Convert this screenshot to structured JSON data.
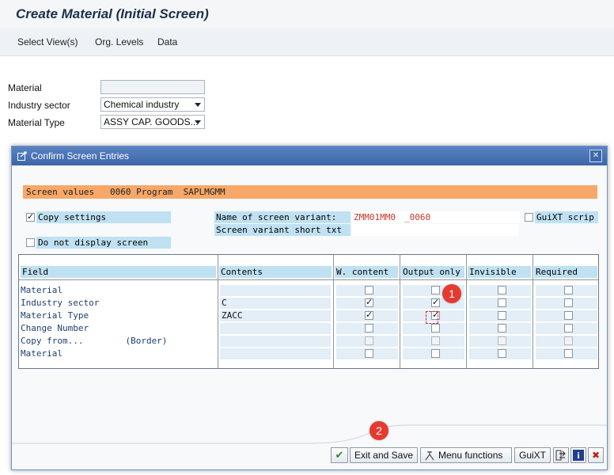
{
  "screen": {
    "title": "Create Material (Initial Screen)",
    "menu": [
      "Select View(s)",
      "Org. Levels",
      "Data"
    ],
    "fields": {
      "material_label": "Material",
      "material_value": "",
      "industry_label": "Industry sector",
      "industry_value": "Chemical industry",
      "type_label": "Material Type",
      "type_value": "ASSY CAP. GOODS..."
    }
  },
  "dialog": {
    "title": "Confirm Screen Entries",
    "close_glyph": "✕",
    "header_strip": "Screen values   0060 Program  SAPLMGMM",
    "copy_settings_label": "Copy settings",
    "copy_settings_checked": true,
    "do_not_display_label": "Do not display screen",
    "do_not_display_checked": false,
    "variant_name_label": "Name of screen variant:",
    "variant_name_value": "ZMM01MM0",
    "variant_suffix_value": "_0060",
    "variant_short_label": "Screen variant short txt",
    "guixt_label": "GuiXT scrip",
    "guixt_checked": false,
    "table": {
      "headers": [
        "Field",
        "Contents",
        "W. content",
        "Output only",
        "Invisible",
        "Required"
      ],
      "rows": [
        {
          "field": "Material",
          "contents": "",
          "w_content": false,
          "output_only": false,
          "invisible": false,
          "required": false,
          "disabled": false
        },
        {
          "field": "Industry sector",
          "contents": "C",
          "w_content": true,
          "output_only": true,
          "invisible": false,
          "required": false,
          "disabled": false
        },
        {
          "field": "Material Type",
          "contents": "ZACC",
          "w_content": true,
          "output_only": true,
          "invisible": false,
          "required": false,
          "disabled": false
        },
        {
          "field": "Change Number",
          "contents": "",
          "w_content": false,
          "output_only": false,
          "invisible": false,
          "required": false,
          "disabled": false
        },
        {
          "field": "Copy from...        (Border)",
          "contents": "",
          "w_content": false,
          "output_only": false,
          "invisible": false,
          "required": false,
          "disabled": true
        },
        {
          "field": "Material",
          "contents": "",
          "w_content": false,
          "output_only": false,
          "invisible": false,
          "required": false,
          "disabled": false
        }
      ]
    },
    "buttons": {
      "confirm_icon": "✔",
      "exit_save": "Exit and Save",
      "menu_functions": "Menu functions",
      "guixt": "GuiXT",
      "info": "i",
      "cancel": "✖"
    }
  },
  "annotations": {
    "badge1": "1",
    "badge2": "2"
  },
  "colors": {
    "accent_orange": "#f7a868",
    "label_blue": "#bfe1f2",
    "badge_red": "#e53a30",
    "variant_red": "#c0392b"
  }
}
